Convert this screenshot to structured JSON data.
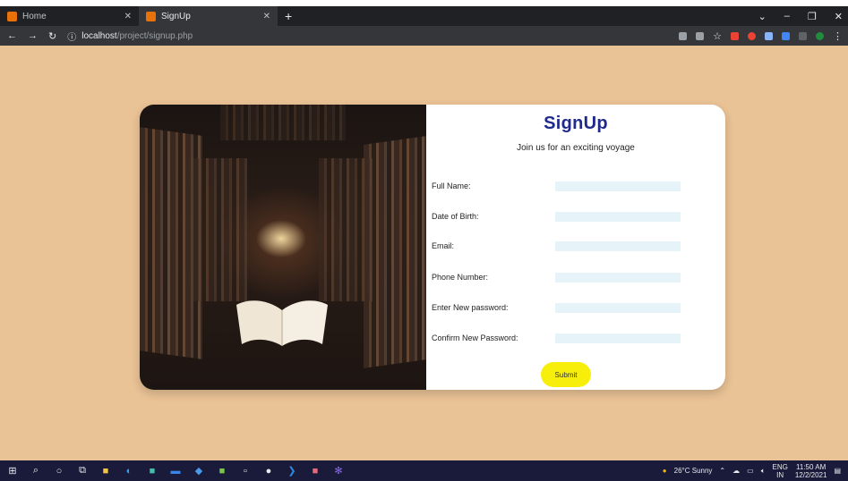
{
  "browser": {
    "tabs": [
      {
        "title": "Home",
        "active": false
      },
      {
        "title": "SignUp",
        "active": true
      }
    ],
    "new_tab": "+",
    "url_host": "localhost",
    "url_path": "/project/signup.php",
    "window_controls": [
      "chevron-down-icon",
      "minimize-icon",
      "maximize-icon",
      "close-icon"
    ]
  },
  "form": {
    "title": "SignUp",
    "subtitle": "Join us for an exciting voyage",
    "fields": [
      {
        "label": "Full Name:",
        "value": ""
      },
      {
        "label": "Date of Birth:",
        "value": ""
      },
      {
        "label": "Email:",
        "value": ""
      },
      {
        "label": "Phone Number:",
        "value": ""
      },
      {
        "label": "Enter New password:",
        "value": ""
      },
      {
        "label": "Confirm New Password:",
        "value": ""
      }
    ],
    "submit_label": "Submit",
    "accent_color": "#1f2a8a",
    "button_color": "#f7ef0b",
    "background_color": "#e9c295"
  },
  "taskbar": {
    "weather": "26°C Sunny",
    "language": "ENG",
    "language_region": "IN",
    "time": "11:50 AM",
    "date": "12/2/2021"
  }
}
